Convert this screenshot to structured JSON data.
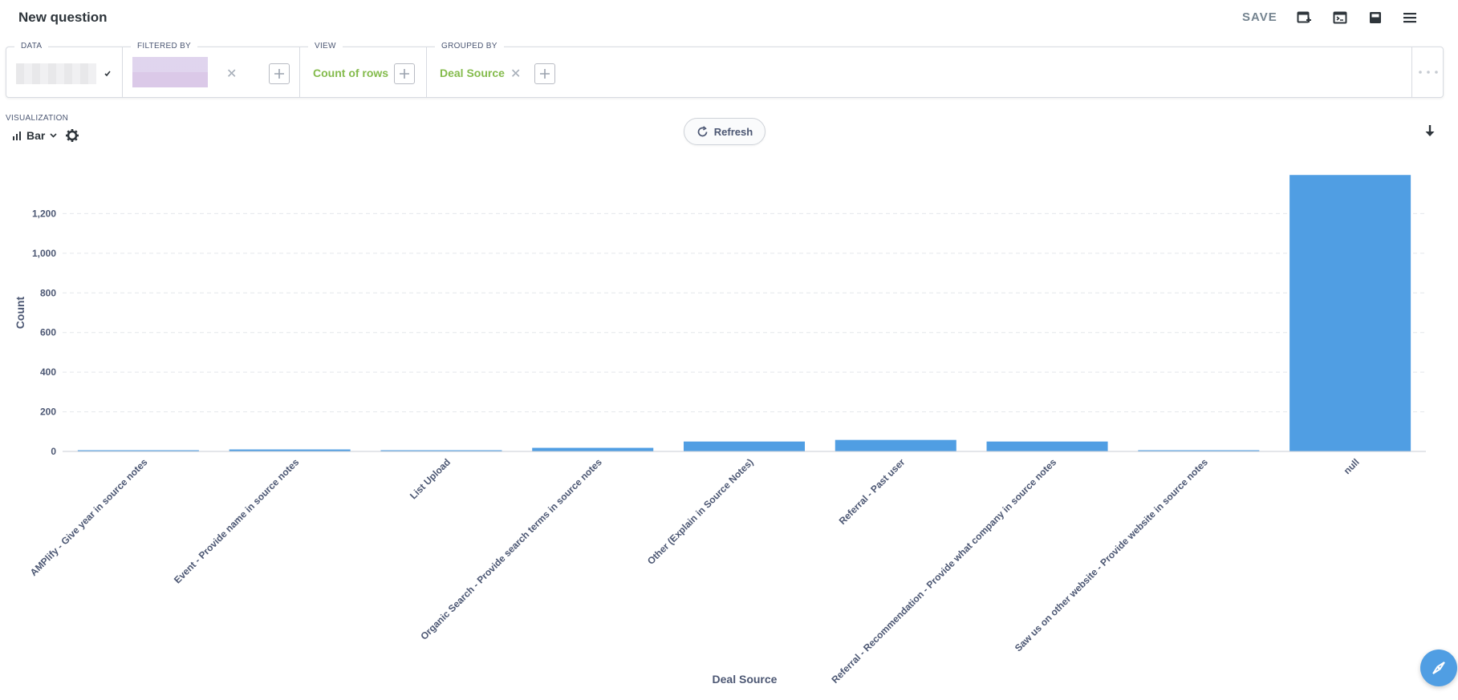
{
  "header": {
    "title": "New question",
    "save_label": "SAVE",
    "icons": [
      "add-to-dashboard-icon",
      "sql-console-icon",
      "notebook-icon",
      "menu-icon"
    ]
  },
  "query_builder": {
    "data_label": "DATA",
    "filtered_by_label": "FILTERED BY",
    "view_label": "VIEW",
    "view_value": "Count of rows",
    "grouped_by_label": "GROUPED BY",
    "grouped_by_value": "Deal Source"
  },
  "visualization": {
    "label": "VISUALIZATION",
    "type_label": "Bar",
    "refresh_label": "Refresh"
  },
  "colors": {
    "bar": "#509ee3",
    "accent_green": "#84bb4c",
    "text": "#4c5773"
  },
  "chart_data": {
    "type": "bar",
    "xlabel": "Deal Source",
    "ylabel": "Count",
    "ylim": [
      0,
      1400
    ],
    "yticks": [
      0,
      200,
      400,
      600,
      800,
      1000,
      1200
    ],
    "ytick_labels": [
      "0",
      "200",
      "400",
      "600",
      "800",
      "1,000",
      "1,200"
    ],
    "grid": true,
    "categories": [
      "AMPlify - Give year in source notes",
      "Event - Provide name in source notes",
      "List Upload",
      "Organic Search - Provide search terms in source notes",
      "Other (Explain in Source Notes)",
      "Referral - Past user",
      "Referral - Recommendation - Provide what company in source notes",
      "Saw us on other website - Provide website in source notes",
      "null"
    ],
    "values": [
      2,
      10,
      2,
      18,
      50,
      58,
      50,
      2,
      1395
    ]
  }
}
